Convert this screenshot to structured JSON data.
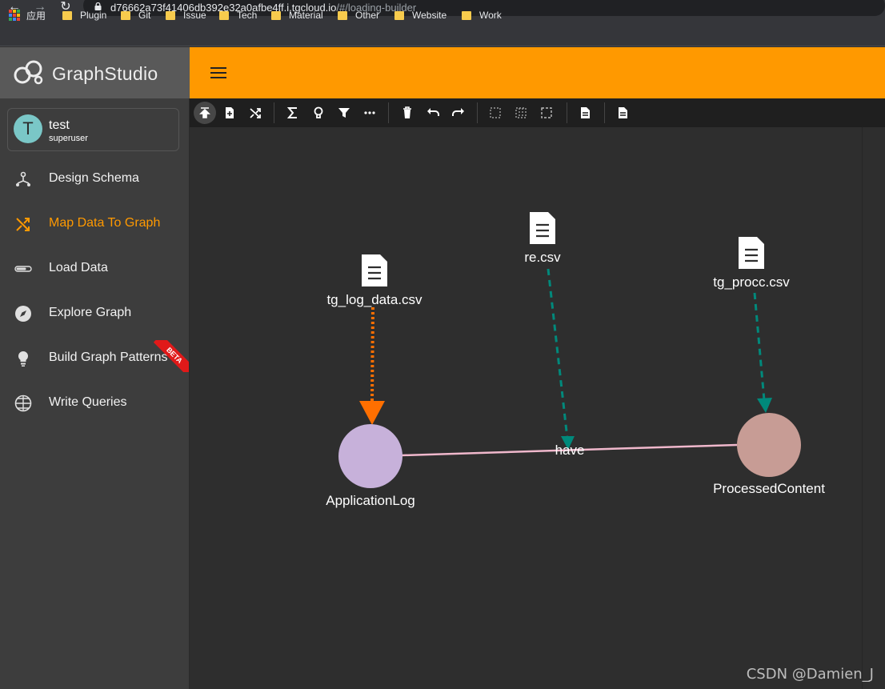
{
  "browser": {
    "url_host": "d76662a73f41406db392e32a0afbe4ff.i.tgcloud.io",
    "url_path": "/#/loading-builder",
    "bookmarks": [
      {
        "label": "应用",
        "icon": "apps-grid-icon"
      },
      {
        "label": "Plugin",
        "icon": "folder-icon"
      },
      {
        "label": "Git",
        "icon": "folder-icon"
      },
      {
        "label": "Issue",
        "icon": "folder-icon"
      },
      {
        "label": "Tech",
        "icon": "folder-icon"
      },
      {
        "label": "Material",
        "icon": "folder-icon"
      },
      {
        "label": "Other",
        "icon": "folder-icon"
      },
      {
        "label": "Website",
        "icon": "folder-icon"
      },
      {
        "label": "Work",
        "icon": "folder-icon"
      }
    ]
  },
  "app": {
    "logo_text": "GraphStudio",
    "accent_color": "#ff9900"
  },
  "user": {
    "initial": "T",
    "name": "test",
    "role": "superuser"
  },
  "sidebar": {
    "items": [
      {
        "label": "Design Schema",
        "icon": "schema-icon",
        "active": false
      },
      {
        "label": "Map Data To Graph",
        "icon": "shuffle-icon",
        "active": true
      },
      {
        "label": "Load Data",
        "icon": "progress-bar-icon",
        "active": false
      },
      {
        "label": "Explore Graph",
        "icon": "compass-icon",
        "active": false
      },
      {
        "label": "Build Graph Patterns",
        "icon": "lightbulb-icon",
        "active": false,
        "badge": "BETA"
      },
      {
        "label": "Write Queries",
        "icon": "globe-icon",
        "active": false
      }
    ]
  },
  "toolbar": {
    "buttons": [
      "publish-icon",
      "add-file-icon",
      "map-icon",
      "sum-icon",
      "lightbulb-icon",
      "filter-icon",
      "more-icon",
      "delete-icon",
      "undo-icon",
      "redo-icon",
      "select-box-icon",
      "select-columns-icon",
      "select-area-icon",
      "document-icon",
      "document-icon"
    ]
  },
  "graph": {
    "files": [
      {
        "label": "tg_log_data.csv"
      },
      {
        "label": "re.csv"
      },
      {
        "label": "tg_procc.csv"
      }
    ],
    "vertices": [
      {
        "label": "ApplicationLog",
        "color": "#c7b1da"
      },
      {
        "label": "ProcessedContent",
        "color": "#c79c95"
      }
    ],
    "edges": [
      {
        "label": "have",
        "color": "#f0b8cc"
      }
    ],
    "mapping_colors": {
      "vertex_mapping": "#ff6f00",
      "edge_mapping": "#00897b"
    }
  },
  "watermark": "CSDN @Damien_J"
}
